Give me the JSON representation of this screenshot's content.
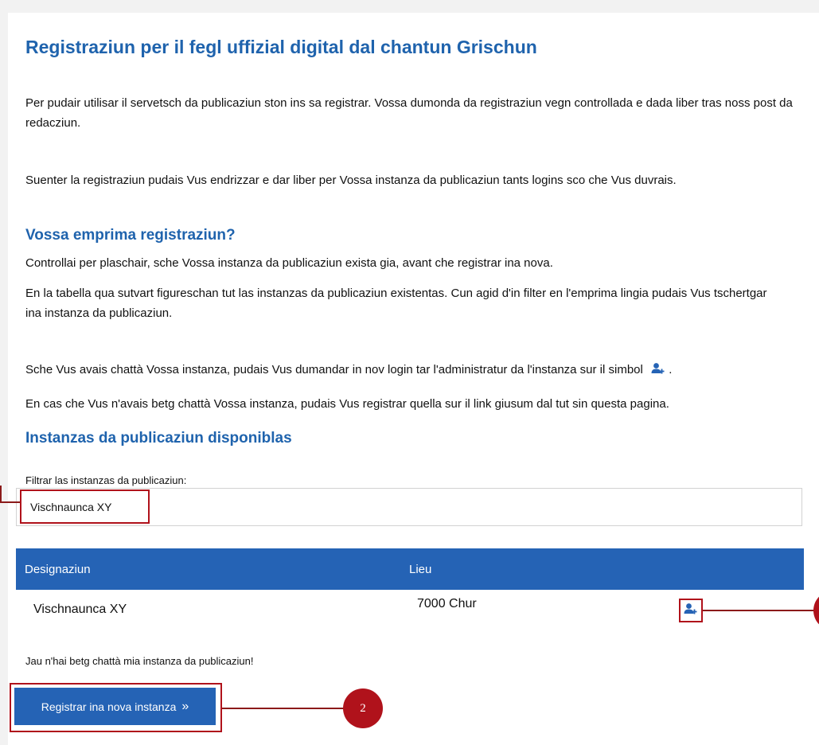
{
  "page": {
    "title": "Registraziun per il fegl uffizial digital dal chantun Grischun",
    "intro_1": "Per pudair utilisar il servetsch da publicaziun ston ins sa registrar. Vossa dumonda da registraziun vegn controllada e dada liber tras noss post da redacziun.",
    "intro_2": "Suenter la registraziun pudais Vus endrizzar e dar liber per Vossa instanza da publicaziun tants logins sco che Vus duvrais."
  },
  "first_registration": {
    "heading": "Vossa emprima registraziun?",
    "p1": "Controllai per plaschair, sche Vossa instanza da publicaziun exista gia, avant che registrar ina nova.",
    "p2": "En la tabella qua sutvart figureschan tut las instanzas da publicaziun existentas. Cun agid d'in filter en l'emprima lingia pudais Vus tschertgar ina instanza da publicaziun.",
    "p3": "Sche Vus avais chattà Vossa instanza, pudais Vus dumandar in nov login tar l'administratur da l'instanza sur il simbol",
    "p3_end": ".",
    "p4": "En cas che Vus n'avais betg chattà Vossa instanza, pudais Vus registrar quella sur il link giusum dal tut sin questa pagina."
  },
  "instances": {
    "heading": "Instanzas da publicaziun disponiblas",
    "filter_label": "Filtrar las instanzas da publicaziun:",
    "filter_value": "Vischnaunca XY",
    "columns": [
      "Designaziun",
      "Lieu"
    ],
    "rows": [
      {
        "name": "Vischnaunca XY",
        "place": "7000 Chur",
        "action_icon": "add-user-icon"
      }
    ],
    "not_found_text": "Jau n'hai betg chattà mia instanza da publicaziun!",
    "register_button": "Registrar ina nova instanza",
    "register_button_icon": "double-chevron-right-icon"
  },
  "callouts": {
    "button_marker": "2"
  },
  "colors": {
    "brand_blue": "#2563b5",
    "heading_blue": "#1f63ad",
    "highlight_red": "#b0121b"
  }
}
